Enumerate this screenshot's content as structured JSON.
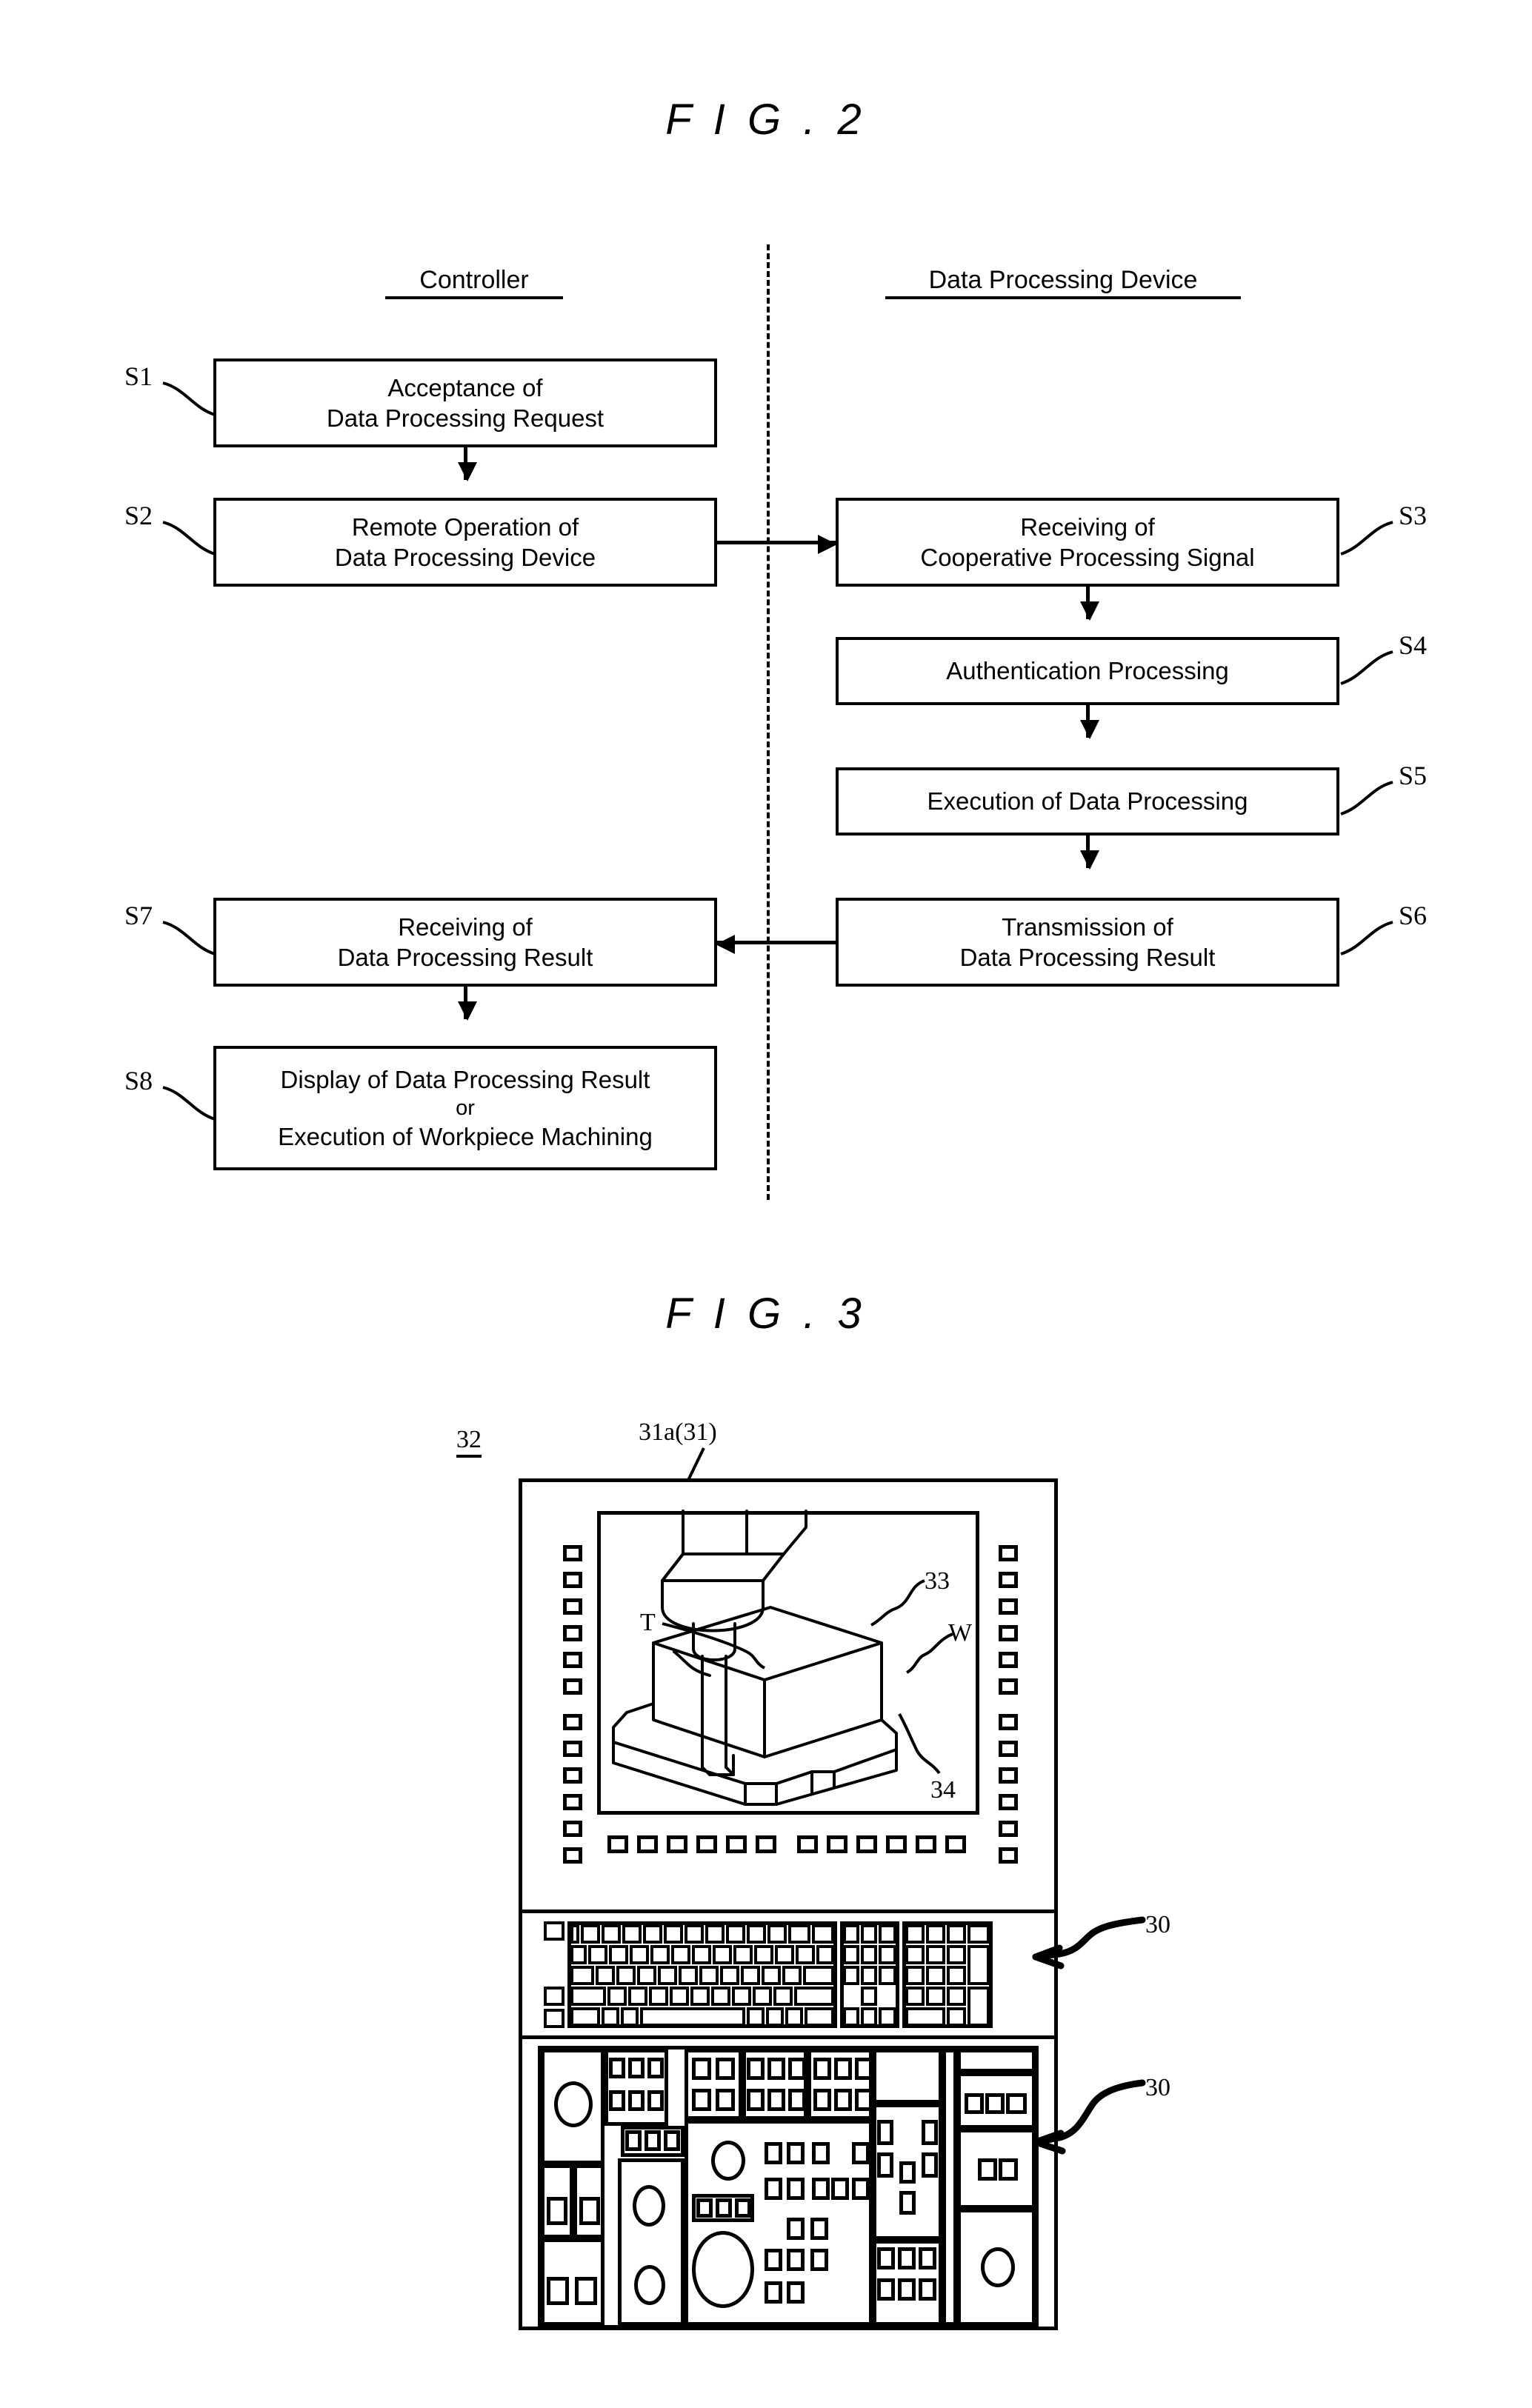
{
  "figures": [
    {
      "id": "fig2",
      "title": "F I G . 2"
    },
    {
      "id": "fig3",
      "title": "F I G . 3"
    }
  ],
  "fig2": {
    "title": "F I G . 2",
    "columns": [
      {
        "id": "controller",
        "label": "Controller"
      },
      {
        "id": "data-processing-device",
        "label": "Data Processing Device"
      }
    ],
    "steps": [
      {
        "id": "S1",
        "tag": "S1",
        "tag_side": "left",
        "lines": [
          "Acceptance of",
          "Data Processing Request"
        ]
      },
      {
        "id": "S2",
        "tag": "S2",
        "tag_side": "left",
        "lines": [
          "Remote Operation of",
          "Data Processing Device"
        ]
      },
      {
        "id": "S3",
        "tag": "S3",
        "tag_side": "right",
        "lines": [
          "Receiving of",
          "Cooperative Processing Signal"
        ]
      },
      {
        "id": "S4",
        "tag": "S4",
        "tag_side": "right",
        "lines": [
          "Authentication Processing"
        ]
      },
      {
        "id": "S5",
        "tag": "S5",
        "tag_side": "right",
        "lines": [
          "Execution of Data Processing"
        ]
      },
      {
        "id": "S6",
        "tag": "S6",
        "tag_side": "right",
        "lines": [
          "Transmission of",
          "Data Processing Result"
        ]
      },
      {
        "id": "S7",
        "tag": "S7",
        "tag_side": "left",
        "lines": [
          "Receiving of",
          "Data Processing Result"
        ]
      },
      {
        "id": "S8",
        "tag": "S8",
        "tag_side": "left",
        "lines": [
          "Display of Data Processing Result",
          "or",
          "Execution of Workpiece Machining"
        ]
      }
    ]
  },
  "fig3": {
    "title": "F I G . 3",
    "refs": [
      {
        "id": "cabinet",
        "label": "32",
        "underline": true
      },
      {
        "id": "screen-display",
        "label": "31a(31)",
        "underline": false
      },
      {
        "id": "spindle-head",
        "label": "33",
        "underline": false
      },
      {
        "id": "tool",
        "label": "T",
        "underline": false
      },
      {
        "id": "workpiece",
        "label": "W",
        "underline": false
      },
      {
        "id": "table-fixture",
        "label": "34",
        "underline": false
      },
      {
        "id": "keyboard-input",
        "label": "30",
        "underline": false
      },
      {
        "id": "operator-panel-input",
        "label": "30",
        "underline": false
      }
    ],
    "softkeys": {
      "side_left_count": 13,
      "side_right_count": 13,
      "bottom_left_count": 6,
      "bottom_right_count": 6
    }
  },
  "colors": {
    "ink": "#000000",
    "paper": "#ffffff"
  }
}
